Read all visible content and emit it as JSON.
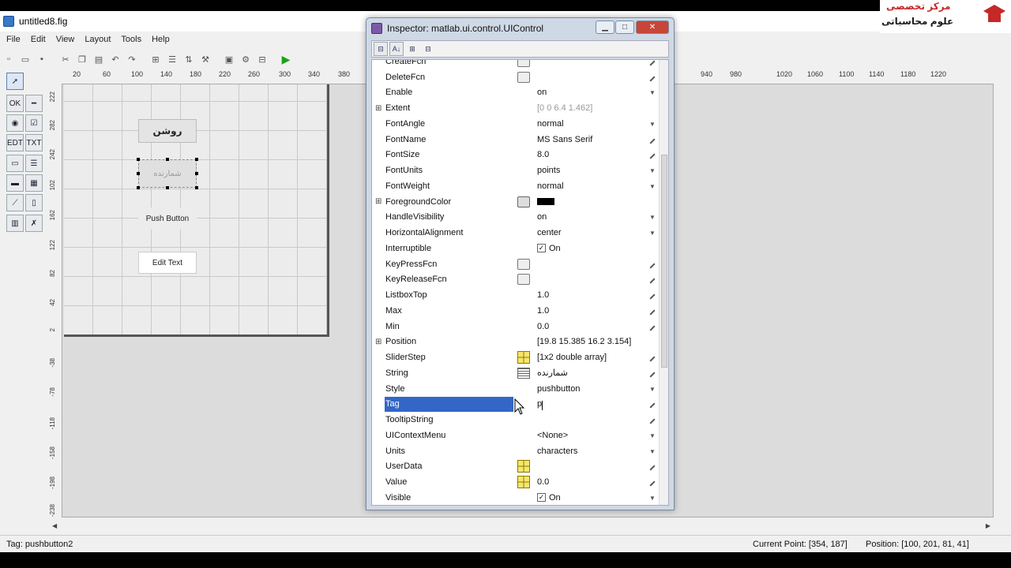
{
  "guide": {
    "title": "untitled8.fig",
    "menu": [
      "File",
      "Edit",
      "View",
      "Layout",
      "Tools",
      "Help"
    ],
    "hruler_labels": [
      "20",
      "60",
      "100",
      "140",
      "180",
      "220",
      "260",
      "300",
      "340",
      "380",
      "940",
      "980",
      "1020",
      "1060",
      "1100",
      "1140",
      "1180",
      "1220"
    ],
    "vruler_labels": [
      "222",
      "282",
      "242",
      "102",
      "162",
      "122",
      "82",
      "42",
      "2",
      "-38",
      "-78",
      "-118",
      "-158",
      "-198",
      "-238"
    ],
    "controls": {
      "button1": "روشن",
      "button2": "شمارنده",
      "push_button": "Push Button",
      "edit_text": "Edit Text"
    },
    "status": {
      "tag": "Tag: pushbutton2",
      "current_point": "Current Point:  [354, 187]",
      "position": "Position:  [100, 201, 81, 41]"
    }
  },
  "logo": {
    "line1": "مرکز تخصصی",
    "line2": "علوم محاسباتی"
  },
  "inspector": {
    "title": "Inspector:  matlab.ui.control.UIControl",
    "properties": [
      {
        "name": "CreateFcn",
        "icon": "fn-icon",
        "value": "",
        "edit": "pencil"
      },
      {
        "name": "DeleteFcn",
        "icon": "fn-icon",
        "value": "",
        "edit": "pencil"
      },
      {
        "name": "Enable",
        "icon": "",
        "value": "on",
        "edit": "dropdown"
      },
      {
        "name": "Extent",
        "expand": true,
        "icon": "",
        "value": "[0 0 6.4 1.462]",
        "dim": true,
        "edit": ""
      },
      {
        "name": "FontAngle",
        "icon": "",
        "value": "normal",
        "edit": "dropdown"
      },
      {
        "name": "FontName",
        "icon": "",
        "value": "MS Sans Serif",
        "edit": "pencil"
      },
      {
        "name": "FontSize",
        "icon": "",
        "value": "8.0",
        "edit": "pencil"
      },
      {
        "name": "FontUnits",
        "icon": "",
        "value": "points",
        "edit": "dropdown"
      },
      {
        "name": "FontWeight",
        "icon": "",
        "value": "normal",
        "edit": "dropdown"
      },
      {
        "name": "ForegroundColor",
        "expand": true,
        "icon": "color-icon",
        "value": "",
        "swatch": "#000000",
        "edit": ""
      },
      {
        "name": "HandleVisibility",
        "icon": "",
        "value": "on",
        "edit": "dropdown"
      },
      {
        "name": "HorizontalAlignment",
        "icon": "",
        "value": "center",
        "edit": "dropdown"
      },
      {
        "name": "Interruptible",
        "icon": "",
        "value": "On",
        "check": true,
        "edit": ""
      },
      {
        "name": "KeyPressFcn",
        "icon": "fn-icon",
        "value": "",
        "edit": "pencil"
      },
      {
        "name": "KeyReleaseFcn",
        "icon": "fn-icon",
        "value": "",
        "edit": "pencil"
      },
      {
        "name": "ListboxTop",
        "icon": "",
        "value": "1.0",
        "edit": "pencil"
      },
      {
        "name": "Max",
        "icon": "",
        "value": "1.0",
        "edit": "pencil"
      },
      {
        "name": "Min",
        "icon": "",
        "value": "0.0",
        "edit": "pencil"
      },
      {
        "name": "Position",
        "expand": true,
        "icon": "",
        "value": "[19.8 15.385 16.2 3.154]",
        "edit": ""
      },
      {
        "name": "SliderStep",
        "icon": "grid-icon",
        "value": "[1x2  double array]",
        "edit": "pencil"
      },
      {
        "name": "String",
        "icon": "text-icon",
        "value": "شمارنده",
        "edit": "pencil"
      },
      {
        "name": "Style",
        "icon": "",
        "value": "pushbutton",
        "edit": "dropdown"
      },
      {
        "name": "Tag",
        "icon": "",
        "value": "p",
        "selected": true,
        "edit": "pencil"
      },
      {
        "name": "TooltipString",
        "icon": "",
        "value": "",
        "edit": "pencil"
      },
      {
        "name": "UIContextMenu",
        "icon": "",
        "value": "<None>",
        "edit": "dropdown"
      },
      {
        "name": "Units",
        "icon": "",
        "value": "characters",
        "edit": "dropdown"
      },
      {
        "name": "UserData",
        "icon": "grid-icon",
        "value": "",
        "edit": "pencil"
      },
      {
        "name": "Value",
        "icon": "grid-icon",
        "value": "0.0",
        "edit": "pencil"
      },
      {
        "name": "Visible",
        "icon": "",
        "value": "On",
        "check": true,
        "edit": "dropdown"
      }
    ]
  },
  "colors": {
    "selection": "#3267c8",
    "run": "#1aa31a",
    "logo_red": "#c62828"
  }
}
